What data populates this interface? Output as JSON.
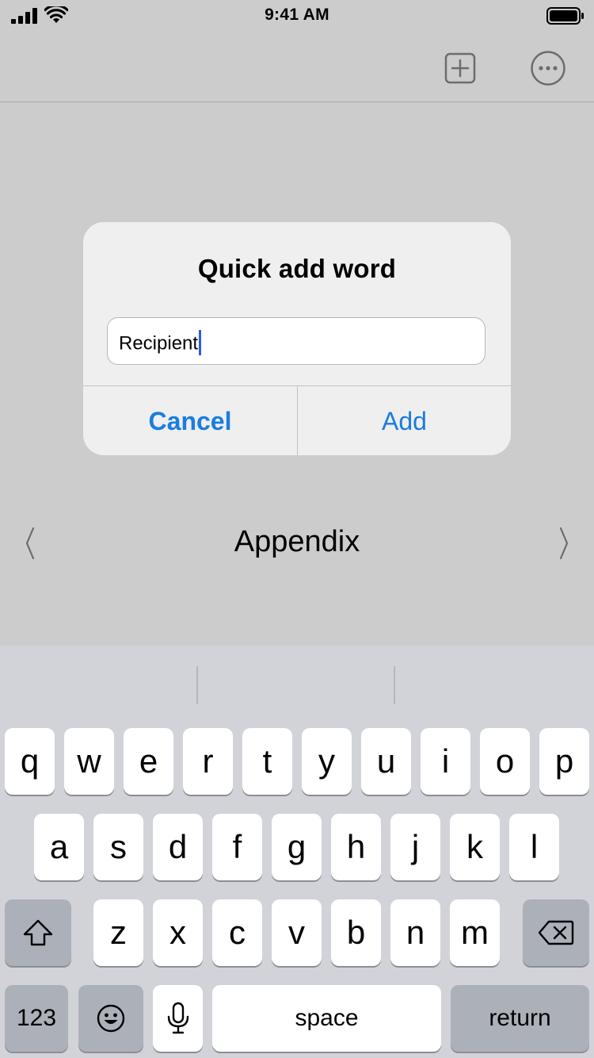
{
  "status_bar": {
    "time": "9:41 AM"
  },
  "nav": {
    "add_icon": "plus-square-icon",
    "more_icon": "ellipsis-circle-icon"
  },
  "dialog": {
    "title": "Quick add word",
    "field_value": "Recipient",
    "cancel_label": "Cancel",
    "confirm_label": "Add"
  },
  "page_nav": {
    "label": "Appendix",
    "prev_icon": "chevron-left-icon",
    "next_icon": "chevron-right-icon"
  },
  "keyboard": {
    "row1": [
      "q",
      "w",
      "e",
      "r",
      "t",
      "y",
      "u",
      "i",
      "o",
      "p"
    ],
    "row2": [
      "a",
      "s",
      "d",
      "f",
      "g",
      "h",
      "j",
      "k",
      "l"
    ],
    "row3": [
      "z",
      "x",
      "c",
      "v",
      "b",
      "n",
      "m"
    ],
    "numbers_label": "123",
    "space_label": "space",
    "return_label": "return",
    "shift_icon": "shift-icon",
    "delete_icon": "delete-icon",
    "emoji_icon": "emoji-icon",
    "mic_icon": "microphone-icon"
  },
  "colors": {
    "accent": "#1a7de0",
    "caret": "#2c5ce6",
    "background": "#cccccc",
    "keyboard_bg": "#d1d3d9"
  }
}
